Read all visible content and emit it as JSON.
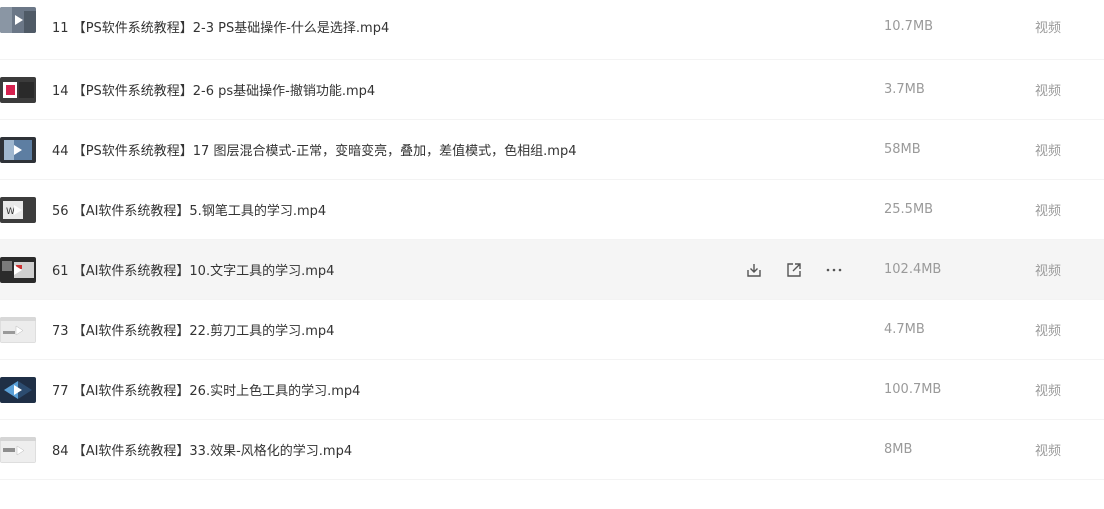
{
  "files": [
    {
      "index": "11",
      "title": "【PS软件系统教程】2-3 PS基础操作-什么是选择.mp4",
      "size": "10.7MB",
      "type": "视频",
      "thumb": "ps-street",
      "thumb_color": "#5b6a7a"
    },
    {
      "index": "14",
      "title": "【PS软件系统教程】2-6 ps基础操作-撤销功能.mp4",
      "size": "3.7MB",
      "type": "视频",
      "thumb": "ps-red",
      "thumb_color": "#d6224f"
    },
    {
      "index": "44",
      "title": "【PS软件系统教程】17 图层混合模式-正常，变暗变亮，叠加，差值模式，色相组.mp4",
      "size": "58MB",
      "type": "视频",
      "thumb": "ps-blend",
      "thumb_color": "#4a6a8a"
    },
    {
      "index": "56",
      "title": "【AI软件系统教程】5.钢笔工具的学习.mp4",
      "size": "25.5MB",
      "type": "视频",
      "thumb": "ai-pen",
      "thumb_color": "#3a3a3a"
    },
    {
      "index": "61",
      "title": "【AI软件系统教程】10.文字工具的学习.mp4",
      "size": "102.4MB",
      "type": "视频",
      "thumb": "ai-text",
      "thumb_color": "#2f2f2f"
    },
    {
      "index": "73",
      "title": "【AI软件系统教程】22.剪刀工具的学习.mp4",
      "size": "4.7MB",
      "type": "视频",
      "thumb": "ai-scissors",
      "thumb_color": "#e6e6e6"
    },
    {
      "index": "77",
      "title": "【AI软件系统教程】26.实时上色工具的学习.mp4",
      "size": "100.7MB",
      "type": "视频",
      "thumb": "ai-livepaint",
      "thumb_color": "#243a5a"
    },
    {
      "index": "84",
      "title": "【AI软件系统教程】33.效果-风格化的学习.mp4",
      "size": "8MB",
      "type": "视频",
      "thumb": "ai-effect",
      "thumb_color": "#e8e8e8"
    }
  ],
  "hover_row": 4,
  "actions": {
    "download_icon": "download-icon",
    "share_icon": "share-icon",
    "more_icon": "more-icon"
  },
  "colors": {
    "text": "#333333",
    "muted": "#9a9a9a",
    "hover": "#f5f5f5",
    "icon": "#555555"
  }
}
